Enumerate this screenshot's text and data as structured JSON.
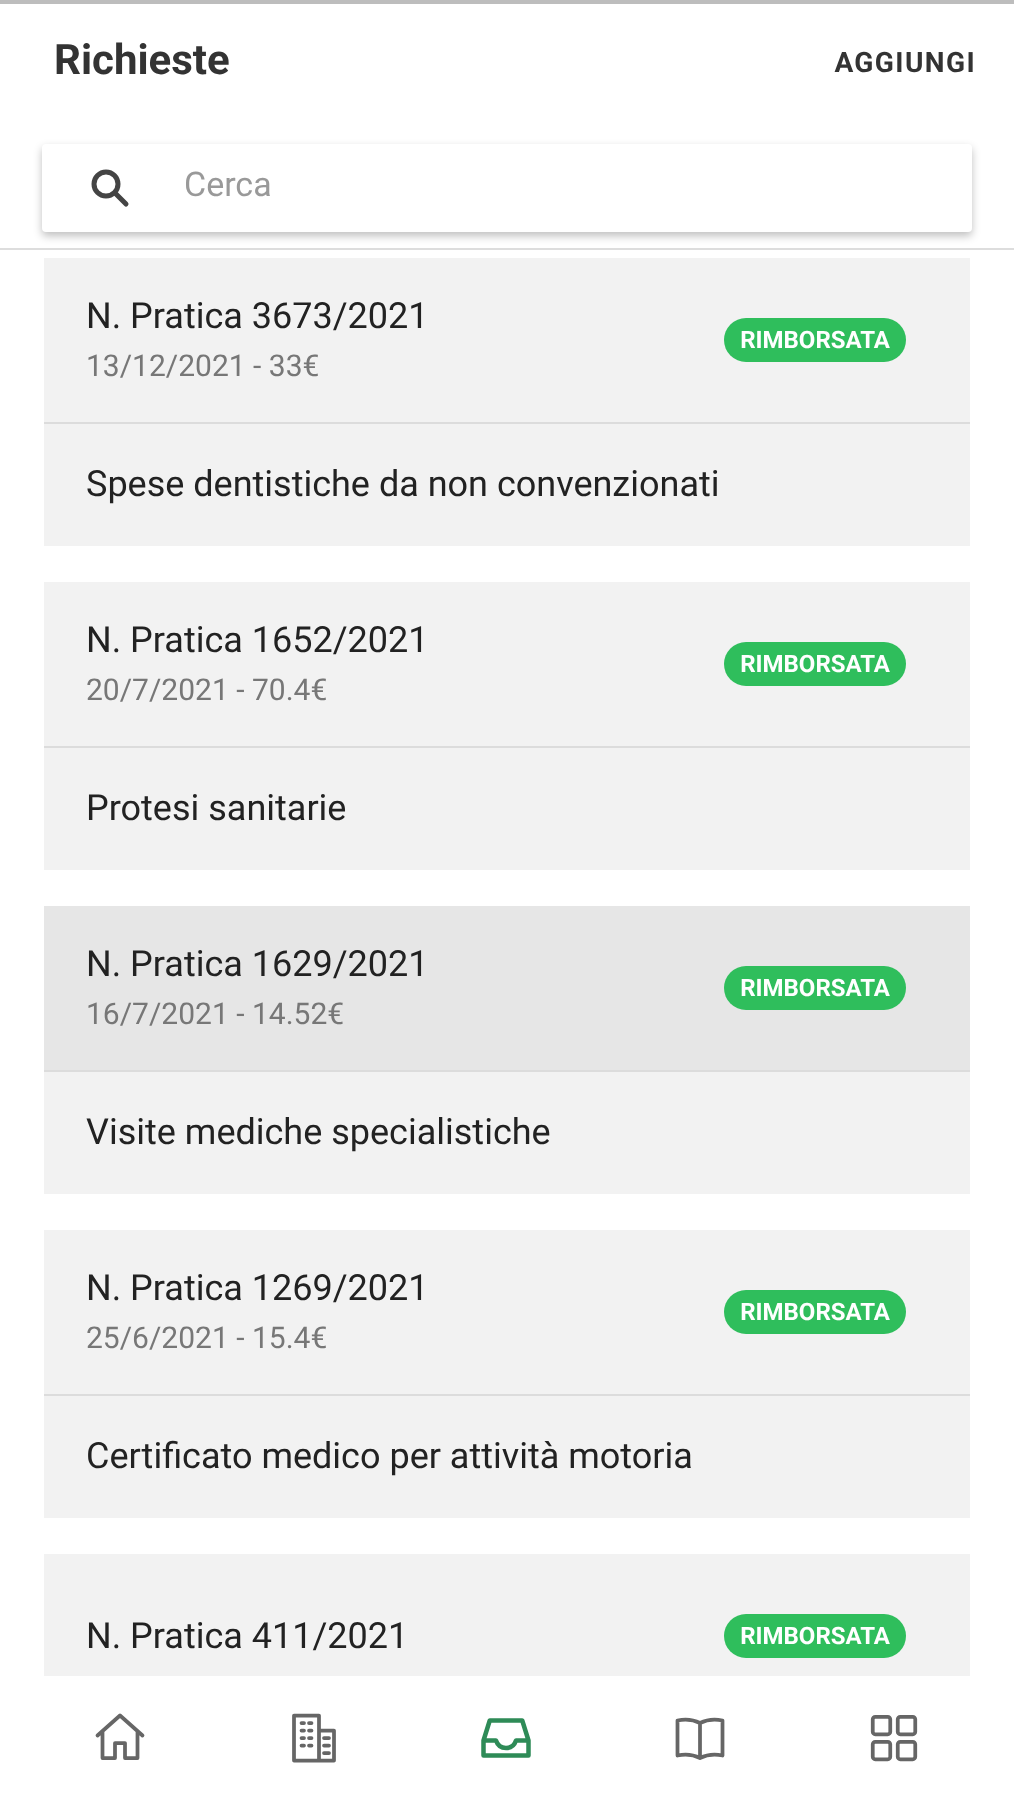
{
  "header": {
    "title": "Richieste",
    "action": "AGGIUNGI"
  },
  "search": {
    "placeholder": "Cerca"
  },
  "requests": [
    {
      "title": "N. Pratica 3673/2021",
      "subtitle": "13/12/2021 - 33€",
      "status": "RIMBORSATA",
      "description": "Spese dentistiche da non convenzionati",
      "selected": false
    },
    {
      "title": "N. Pratica 1652/2021",
      "subtitle": "20/7/2021 - 70.4€",
      "status": "RIMBORSATA",
      "description": "Protesi sanitarie",
      "selected": false
    },
    {
      "title": "N. Pratica 1629/2021",
      "subtitle": "16/7/2021 - 14.52€",
      "status": "RIMBORSATA",
      "description": "Visite mediche specialistiche",
      "selected": true
    },
    {
      "title": "N. Pratica 1269/2021",
      "subtitle": "25/6/2021 - 15.4€",
      "status": "RIMBORSATA",
      "description": "Certificato medico per attività motoria",
      "selected": false
    },
    {
      "title": "N. Pratica 411/2021",
      "status": "RIMBORSATA",
      "selected": false
    }
  ],
  "nav": [
    {
      "kind": "home",
      "selected": false
    },
    {
      "kind": "buildings",
      "selected": false
    },
    {
      "kind": "inbox",
      "selected": true
    },
    {
      "kind": "book",
      "selected": false
    },
    {
      "kind": "grid",
      "selected": false
    }
  ]
}
